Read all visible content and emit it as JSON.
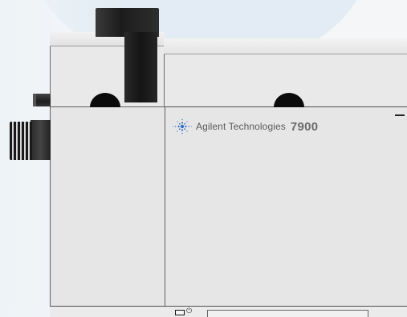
{
  "instrument": {
    "brand": "Agilent Technologies",
    "model": "7900",
    "logo_icon": "agilent-spark-icon",
    "power_icon": "power-icon",
    "power_symbol": "⏻",
    "accent_color": "#2f6fc6"
  }
}
